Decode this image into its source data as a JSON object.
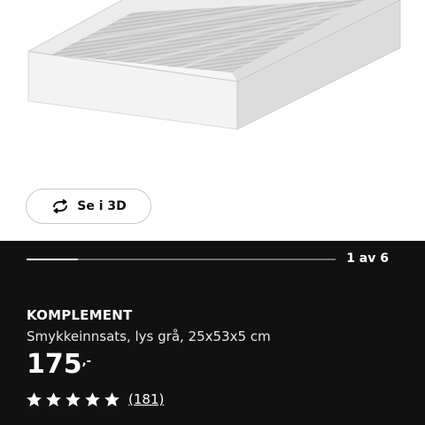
{
  "view_3d": {
    "label": "Se i 3D",
    "icon": "rotate-3d-icon"
  },
  "gallery": {
    "counter": "1 av 6",
    "current_index": 1,
    "total": 6,
    "progress_fraction": 0.167
  },
  "product": {
    "name": "KOMPLEMENT",
    "description": "Smykkeinnsats, lys grå, 25x53x5 cm",
    "price": "175",
    "price_suffix": ",-",
    "rating": 5,
    "rating_max": 5,
    "review_count": "(181)"
  },
  "colors": {
    "panel_background": "#111111",
    "tray_frame": "#e9e9e9",
    "tray_felt": "#c8c8c8"
  }
}
